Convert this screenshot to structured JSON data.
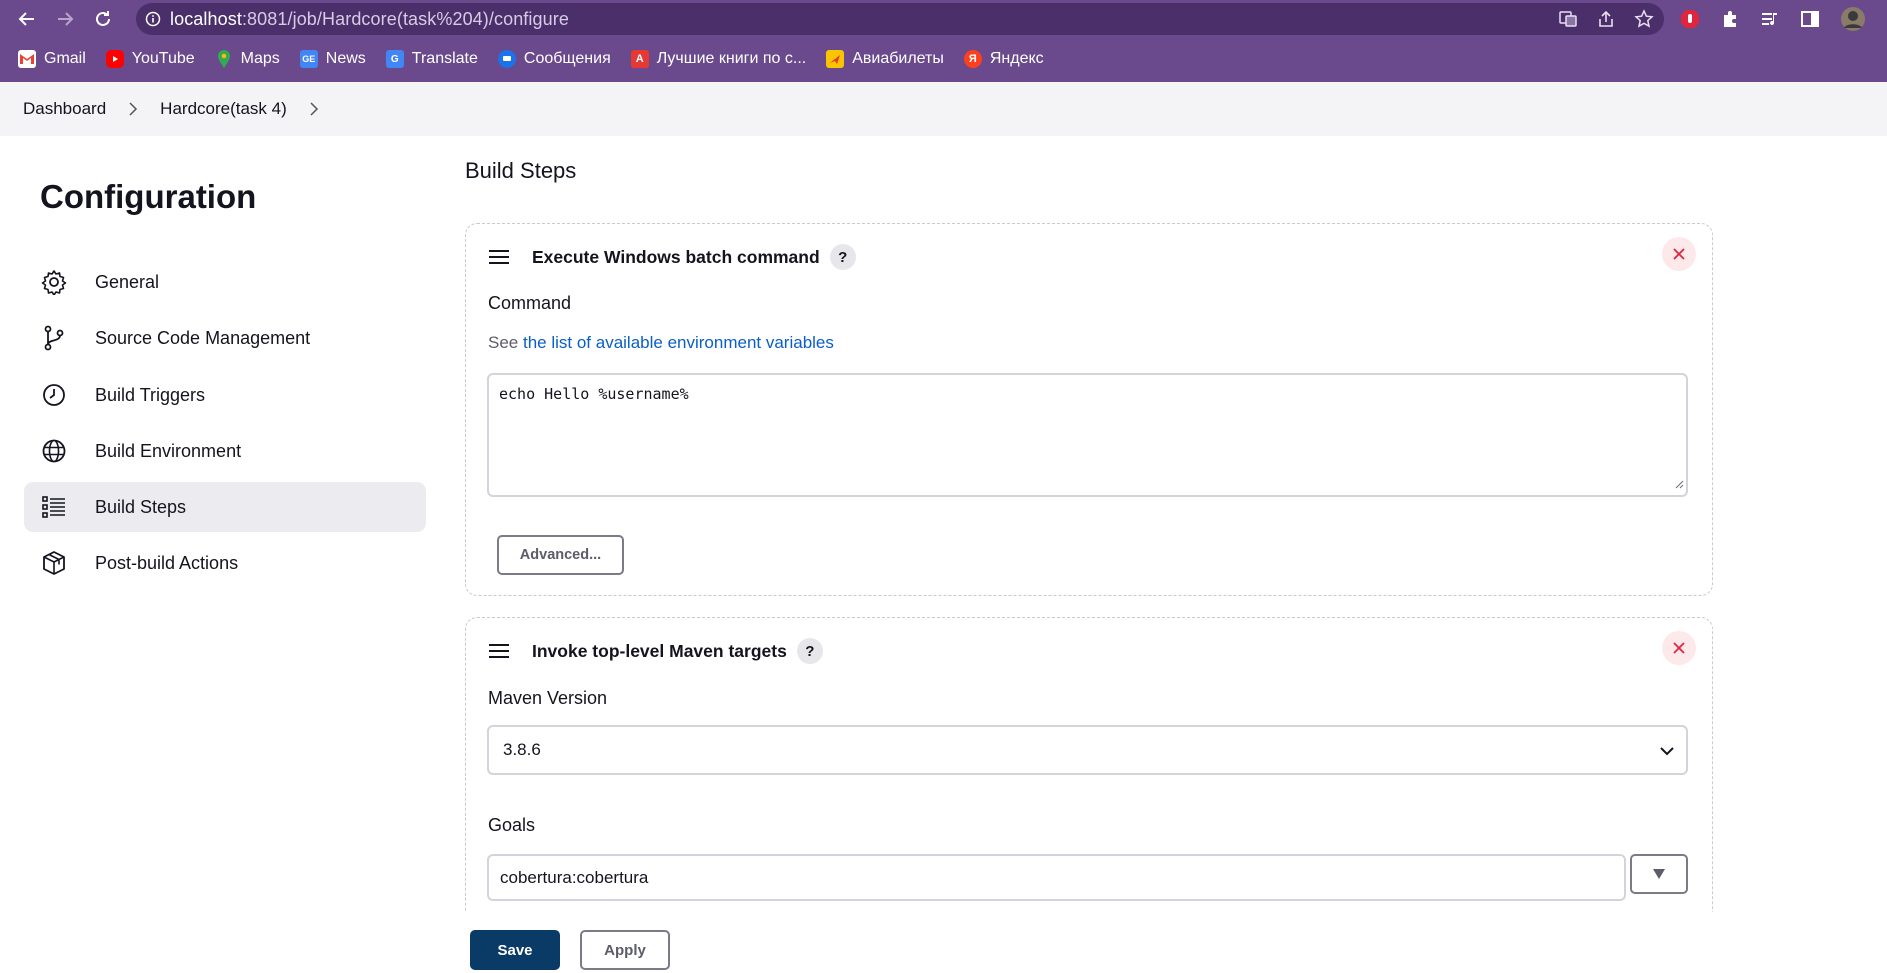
{
  "browser": {
    "url_host": "localhost",
    "url_rest": ":8081/job/Hardcore(task%204)/configure",
    "bookmarks": [
      {
        "label": "Gmail"
      },
      {
        "label": "YouTube"
      },
      {
        "label": "Maps"
      },
      {
        "label": "News"
      },
      {
        "label": "Translate"
      },
      {
        "label": "Сообщения"
      },
      {
        "label": "Лучшие книги по с..."
      },
      {
        "label": "Авиабилеты"
      },
      {
        "label": "Яндекс"
      }
    ]
  },
  "breadcrumb": {
    "items": [
      "Dashboard",
      "Hardcore(task 4)"
    ]
  },
  "sidebar": {
    "title": "Configuration",
    "items": [
      {
        "label": "General",
        "icon": "gear-icon"
      },
      {
        "label": "Source Code Management",
        "icon": "branch-icon"
      },
      {
        "label": "Build Triggers",
        "icon": "clock-icon"
      },
      {
        "label": "Build Environment",
        "icon": "globe-icon"
      },
      {
        "label": "Build Steps",
        "icon": "list-icon",
        "active": true
      },
      {
        "label": "Post-build Actions",
        "icon": "package-icon"
      }
    ]
  },
  "main": {
    "section_title": "Build Steps",
    "step1": {
      "name": "Execute Windows batch command",
      "help": "?",
      "command_label": "Command",
      "see_prefix": "See ",
      "see_link": "the list of available environment variables",
      "command_value": "echo Hello %username%",
      "advanced_label": "Advanced..."
    },
    "step2": {
      "name": "Invoke top-level Maven targets",
      "help": "?",
      "maven_label": "Maven Version",
      "maven_value": "3.8.6",
      "goals_label": "Goals",
      "goals_value": "cobertura:cobertura"
    }
  },
  "footer": {
    "save_label": "Save",
    "apply_label": "Apply"
  },
  "colors": {
    "chrome": "#6a4a8c",
    "primary_button": "#0a3a66",
    "link": "#0a5fc4",
    "danger": "#e0263f"
  }
}
